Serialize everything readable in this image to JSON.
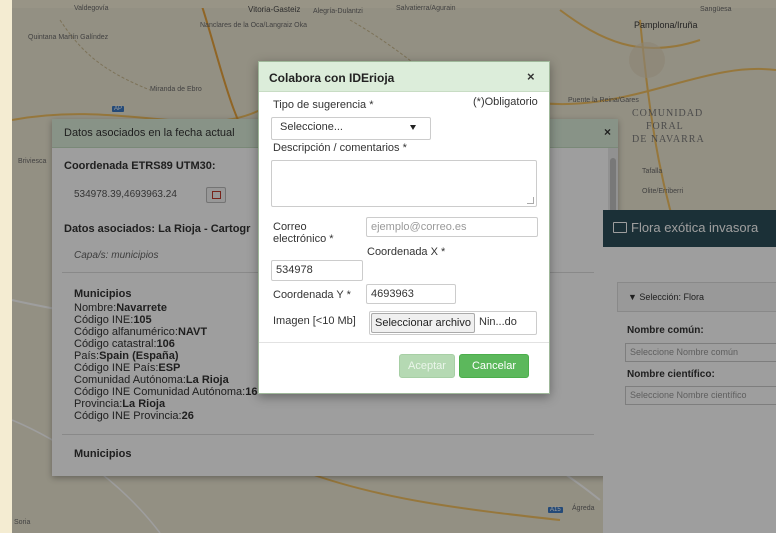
{
  "map": {
    "labels": {
      "vitoria": "Vitoria-Gasteiz",
      "alegria": "Alegría-Dulantzi",
      "salvatierra": "Salvatierra/Agurain",
      "pamplona": "Pamplona/Iruña",
      "sanguesa": "Sangüesa",
      "navarra_region_1": "COMUNIDAD",
      "navarra_region_2": "FORAL",
      "navarra_region_3": "DE NAVARRA",
      "tafalla": "Tafalla",
      "olite": "Olite/Erriberri",
      "puente": "Puente la Reina/Gares",
      "miranda": "Miranda de Ebro",
      "briviesca": "Briviesca",
      "valdegovia": "Valdegovía",
      "nanclares": "Nanclares de la Oca/Langraiz Oka",
      "quintana": "Quintana Martín Galíndez",
      "agreda": "Ágreda",
      "soria": "Soria"
    }
  },
  "info_panel": {
    "title": "Datos asociados en la fecha actual",
    "coord_label": "Coordenada ETRS89 UTM30:",
    "coord_value": "534978.39,4693963.24",
    "assoc_heading": "Datos asociados: La Rioja - Cartogr",
    "layers": "Capa/s: municipios",
    "section_title": "Municipios",
    "section_title_2": "Municipios",
    "rows": [
      {
        "label": "Nombre:",
        "value": "Navarrete"
      },
      {
        "label": "Código INE:",
        "value": "105"
      },
      {
        "label": "Código alfanumérico:",
        "value": "NAVT"
      },
      {
        "label": "Código catastral:",
        "value": "106"
      },
      {
        "label": "País:",
        "value": "Spain (España)"
      },
      {
        "label": "Código INE País:",
        "value": "ESP"
      },
      {
        "label": "Comunidad Autónoma:",
        "value": "La Rioja"
      },
      {
        "label": "Código INE Comunidad Autónoma:",
        "value": "16"
      },
      {
        "label": "Provincia:",
        "value": "La Rioja"
      },
      {
        "label": "Código INE Provincia:",
        "value": "26"
      }
    ]
  },
  "right_panel": {
    "title": "Flora exótica invasora",
    "selection": "Selección: Flora",
    "common_name_label": "Nombre común:",
    "common_name_placeholder": "Seleccione Nombre común",
    "scientific_name_label": "Nombre científico:",
    "scientific_name_placeholder": "Seleccione Nombre científico"
  },
  "modal": {
    "title": "Colabora con IDErioja",
    "close_glyph": "×",
    "required_note": "(*)Obligatorio",
    "type_label": "Tipo de sugerencia *",
    "type_selected": "Seleccione...",
    "description_label": "Descripción / comentarios *",
    "email_label_1": "Correo",
    "email_label_2": "electrónico *",
    "email_placeholder": "ejemplo@correo.es",
    "coord_x_label": "Coordenada X *",
    "coord_x_value": "534978",
    "coord_y_label": "Coordenada Y *",
    "coord_y_value": "4693963",
    "image_label": "Imagen [<10 Mb]",
    "file_button": "Seleccionar archivo",
    "file_status": "Nin...do",
    "accept": "Aceptar",
    "cancel": "Cancelar"
  },
  "colors": {
    "modal_header": "#dcedda",
    "accept_disabled": "#b5d9b3",
    "cancel": "#5cb85c",
    "right_panel_header": "#2d4e5a"
  }
}
